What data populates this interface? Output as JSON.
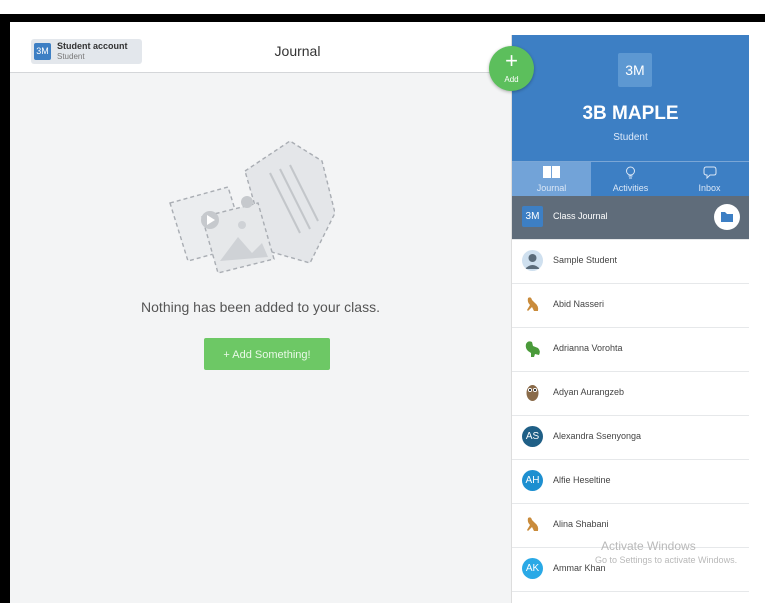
{
  "header": {
    "account_badge": "3M",
    "account_name": "Student account",
    "account_role": "Student",
    "title": "Journal"
  },
  "main": {
    "empty_message": "Nothing has been added to your class.",
    "add_button": "+ Add Something!"
  },
  "fab": {
    "label": "Add",
    "icon": "plus-icon"
  },
  "class_panel": {
    "badge": "3M",
    "name": "3B MAPLE",
    "role": "Student",
    "tabs": [
      {
        "label": "Journal",
        "icon": "book-icon",
        "active": true
      },
      {
        "label": "Activities",
        "icon": "lightbulb-icon",
        "active": false
      },
      {
        "label": "Inbox",
        "icon": "chat-icon",
        "active": false
      }
    ],
    "list": [
      {
        "label": "Class Journal",
        "avatar": "3M",
        "avatar_type": "badge",
        "color": "#3d7fc4",
        "active": true
      },
      {
        "label": "Sample Student",
        "avatar": "",
        "avatar_type": "person-icon",
        "color": "#5a6b7a",
        "active": false
      },
      {
        "label": "Abid Nasseri",
        "avatar": "",
        "avatar_type": "kangaroo-icon",
        "color": "#c98b3b",
        "active": false
      },
      {
        "label": "Adrianna Vorohta",
        "avatar": "",
        "avatar_type": "dinosaur-icon",
        "color": "#4a9a3a",
        "active": false
      },
      {
        "label": "Adyan Aurangzeb",
        "avatar": "",
        "avatar_type": "owl-icon",
        "color": "#8a6b4a",
        "active": false
      },
      {
        "label": "Alexandra Ssenyonga",
        "avatar": "AS",
        "avatar_type": "initials",
        "color": "#1f5f86",
        "active": false
      },
      {
        "label": "Alfie Heseltine",
        "avatar": "AH",
        "avatar_type": "initials",
        "color": "#1d8fd0",
        "active": false
      },
      {
        "label": "Alina Shabani",
        "avatar": "",
        "avatar_type": "kangaroo-icon",
        "color": "#c98b3b",
        "active": false
      },
      {
        "label": "Ammar Khan",
        "avatar": "AK",
        "avatar_type": "initials",
        "color": "#2aa9e6",
        "active": false
      }
    ]
  },
  "watermark": {
    "line1": "Activate Windows",
    "line2": "Go to Settings to activate Windows."
  }
}
